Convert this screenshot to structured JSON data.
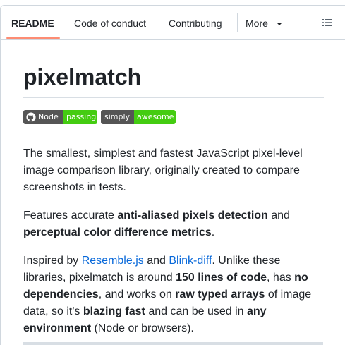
{
  "tabs": [
    {
      "label": "README",
      "active": true
    },
    {
      "label": "Code of conduct"
    },
    {
      "label": "Contributing"
    },
    {
      "label": "More"
    }
  ],
  "icons": {
    "list": "list-unordered-icon",
    "more": "chevron-down-icon",
    "github": "github-mark-icon"
  },
  "readme": {
    "title": "pixelmatch",
    "badges": [
      {
        "label": "Node",
        "status": "passing",
        "status_color": "#44cc11"
      },
      {
        "label": "simply",
        "status": "awesome",
        "status_color": "#44cc11"
      }
    ],
    "p1": "The smallest, simplest and fastest JavaScript pixel-level image comparison library, originally created to compare screenshots in tests.",
    "p2": {
      "t1": "Features accurate ",
      "b1": "anti-aliased pixels detection",
      "t2": " and ",
      "b2": "perceptual color difference metrics",
      "t3": "."
    },
    "p3": {
      "t1": "Inspired by ",
      "link1": "Resemble.js",
      "t2": " and ",
      "link2": "Blink-diff",
      "t3": ". Unlike these libraries, pixelmatch is around ",
      "b1": "150 lines of code",
      "t4": ", has ",
      "b2": "no dependencies",
      "t5": ", and works on ",
      "b3": "raw typed arrays",
      "t6": " of image data, so it's ",
      "b4": "blazing fast",
      "t7": " and can be used in ",
      "b5": "any environment",
      "t8": " (Node or browsers)."
    }
  },
  "colors": {
    "accent_underline": "#fd8c73",
    "link": "#0969da",
    "badge_left": "#555555",
    "badge_right": "#44cc11"
  }
}
